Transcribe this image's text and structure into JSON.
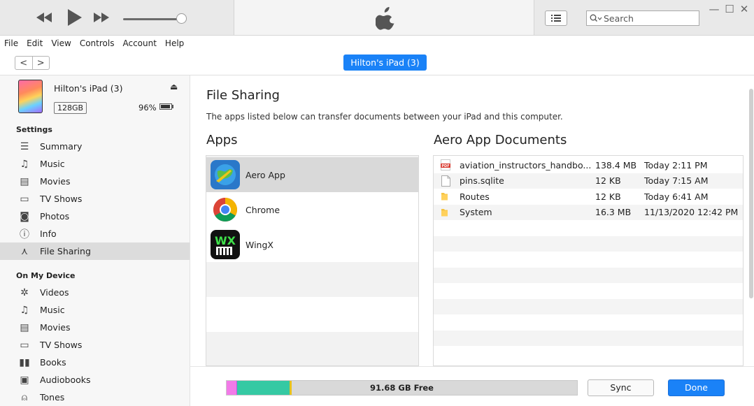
{
  "player": {
    "rewind_icon": "rewind-icon",
    "play_icon": "play-icon",
    "forward_icon": "fast-forward-icon",
    "volume_level": 0.9,
    "search_placeholder": "Search"
  },
  "window_controls": {
    "minimize": "—",
    "maximize": "☐",
    "close": "✕"
  },
  "menu": [
    "File",
    "Edit",
    "View",
    "Controls",
    "Account",
    "Help"
  ],
  "nav": {
    "back": "<",
    "forward": ">",
    "device_tab": "Hilton's iPad (3)"
  },
  "device": {
    "name": "Hilton's iPad (3)",
    "capacity": "128GB",
    "battery": "96%"
  },
  "sidebar": {
    "settings_title": "Settings",
    "settings_items": [
      {
        "label": "Summary",
        "icon": "summary-icon",
        "glyph": "☰"
      },
      {
        "label": "Music",
        "icon": "music-icon",
        "glyph": "♫"
      },
      {
        "label": "Movies",
        "icon": "movies-icon",
        "glyph": "▤"
      },
      {
        "label": "TV Shows",
        "icon": "tv-icon",
        "glyph": "▭"
      },
      {
        "label": "Photos",
        "icon": "photos-icon",
        "glyph": "◙"
      },
      {
        "label": "Info",
        "icon": "info-icon",
        "glyph": "ⓘ"
      },
      {
        "label": "File Sharing",
        "icon": "file-sharing-icon",
        "glyph": "⋏"
      }
    ],
    "device_title": "On My Device",
    "device_items": [
      {
        "label": "Videos",
        "icon": "videos-icon",
        "glyph": "✲"
      },
      {
        "label": "Music",
        "icon": "music-icon",
        "glyph": "♫"
      },
      {
        "label": "Movies",
        "icon": "movies-icon",
        "glyph": "▤"
      },
      {
        "label": "TV Shows",
        "icon": "tv-icon",
        "glyph": "▭"
      },
      {
        "label": "Books",
        "icon": "books-icon",
        "glyph": "▮▮"
      },
      {
        "label": "Audiobooks",
        "icon": "audiobooks-icon",
        "glyph": "▣"
      },
      {
        "label": "Tones",
        "icon": "bell-icon",
        "glyph": "⍝"
      }
    ]
  },
  "main": {
    "title": "File Sharing",
    "description": "The apps listed below can transfer documents between your iPad and this computer.",
    "apps_heading": "Apps",
    "docs_heading": "Aero App Documents",
    "apps": [
      {
        "name": "Aero App",
        "icon": "aero-app-icon",
        "selected": true
      },
      {
        "name": "Chrome",
        "icon": "chrome-icon",
        "selected": false
      },
      {
        "name": "WingX",
        "icon": "wingx-icon",
        "selected": false
      }
    ],
    "documents": [
      {
        "name": "aviation_instructors_handbo...",
        "size": "138.4 MB",
        "date": "Today 2:11 PM",
        "icon": "pdf-icon"
      },
      {
        "name": "pins.sqlite",
        "size": "12 KB",
        "date": "Today 7:15 AM",
        "icon": "file-icon"
      },
      {
        "name": "Routes",
        "size": "12 KB",
        "date": "Today 6:41 AM",
        "icon": "folder-icon"
      },
      {
        "name": "System",
        "size": "16.3 MB",
        "date": "11/13/2020 12:42 PM",
        "icon": "folder-icon"
      }
    ]
  },
  "storage": {
    "free_label": "91.68 GB Free",
    "segments": [
      {
        "name": "Audio",
        "fraction": 0.027,
        "color": "#f27ae8"
      },
      {
        "name": "Apps",
        "fraction": 0.002,
        "color": "#b25ee0"
      },
      {
        "name": "Documents & Data",
        "fraction": 0.15,
        "color": "#35c9a3"
      },
      {
        "name": "Other",
        "fraction": 0.006,
        "color": "#e9c21a"
      },
      {
        "name": "Free",
        "fraction": 0.815,
        "color": "#d9d9d9"
      }
    ]
  },
  "buttons": {
    "sync": "Sync",
    "done": "Done"
  }
}
